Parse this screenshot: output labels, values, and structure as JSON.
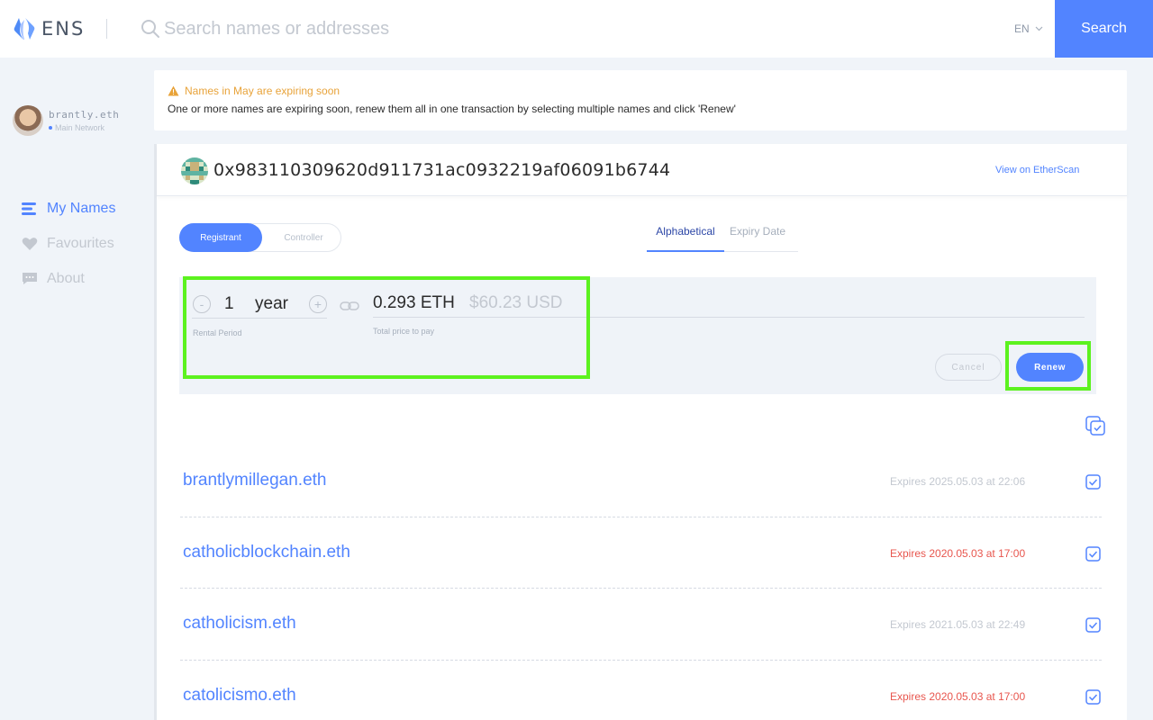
{
  "header": {
    "logo_text": "ENS",
    "search_placeholder": "Search names or addresses",
    "language": "EN",
    "search_button": "Search"
  },
  "sidebar": {
    "account_name": "brantly.eth",
    "network": "Main Network",
    "nav": [
      {
        "label": "My Names",
        "icon": "list-icon",
        "active": true
      },
      {
        "label": "Favourites",
        "icon": "heart-icon",
        "active": false
      },
      {
        "label": "About",
        "icon": "chat-icon",
        "active": false
      }
    ]
  },
  "notice": {
    "title": "Names in May are expiring soon",
    "body": "One or more names are expiring soon, renew them all in one transaction by selecting multiple names and click 'Renew'"
  },
  "address_bar": {
    "address": "0x983110309620d911731ac0932219af06091b6744",
    "etherscan_link": "View on EtherScan"
  },
  "role_toggle": {
    "registrant": "Registrant",
    "controller": "Controller",
    "selected": "Registrant"
  },
  "sort_tabs": {
    "alphabetical": "Alphabetical",
    "expiry": "Expiry Date",
    "selected": "Alphabetical"
  },
  "renew": {
    "minus": "-",
    "plus": "+",
    "years": "1",
    "unit": "year",
    "rental_label": "Rental Period",
    "eth_price": "0.293 ETH",
    "usd_price": "$60.23 USD",
    "price_label": "Total price to pay",
    "cancel": "Cancel",
    "renew": "Renew"
  },
  "names": [
    {
      "name": "brantlymillegan.eth",
      "expiry": "Expires 2025.05.03 at 22:06",
      "expiring_soon": false
    },
    {
      "name": "catholicblockchain.eth",
      "expiry": "Expires 2020.05.03 at 17:00",
      "expiring_soon": true
    },
    {
      "name": "catholicism.eth",
      "expiry": "Expires 2021.05.03 at 22:49",
      "expiring_soon": false
    },
    {
      "name": "catolicismo.eth",
      "expiry": "Expires 2020.05.03 at 17:00",
      "expiring_soon": true
    }
  ],
  "colors": {
    "accent": "#5284ff",
    "warning": "#e8a33a",
    "expiring": "#e8564e",
    "highlight": "#5cf21f"
  }
}
